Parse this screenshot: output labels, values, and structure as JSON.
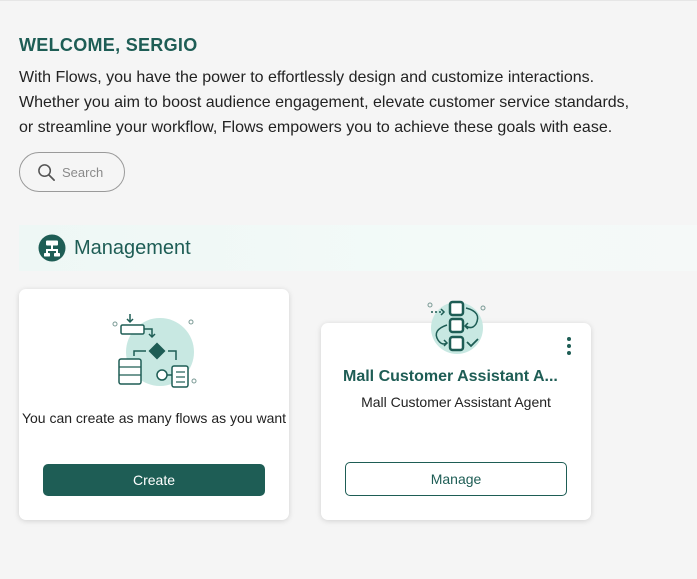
{
  "welcome": {
    "title": "WELCOME, SERGIO"
  },
  "intro": {
    "lines": [
      "With Flows, you have the power to effortlessly design and customize interactions.",
      "Whether you aim to boost audience engagement, elevate customer service standards,",
      "or streamline your workflow, Flows empowers you to achieve these goals with ease."
    ]
  },
  "search": {
    "placeholder": "Search",
    "icon": "search-icon"
  },
  "section": {
    "title": "Management",
    "icon": "management-icon"
  },
  "create_card": {
    "text": "You can create as many flows as you want",
    "button_label": "Create",
    "icon": "flow-diagram-illustration"
  },
  "agent_card": {
    "title": "Mall Customer Assistant A...",
    "subtitle": "Mall Customer Assistant Agent",
    "button_label": "Manage",
    "icon": "agent-flow-illustration",
    "menu_icon": "more-vertical-icon"
  },
  "colors": {
    "brand": "#1e5d55",
    "accent_light": "#bfe3dd",
    "background": "#f5f5f5",
    "card": "#ffffff"
  }
}
